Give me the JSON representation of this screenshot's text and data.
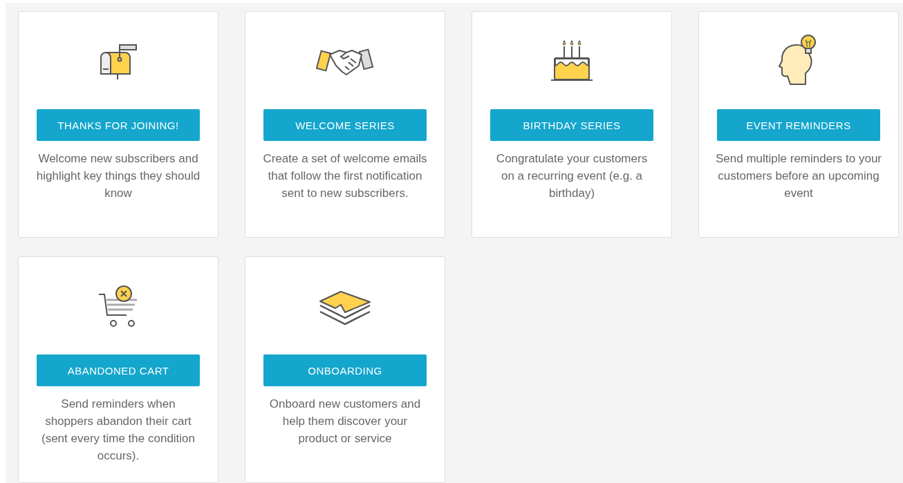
{
  "templates": [
    {
      "button": "THANKS FOR JOINING!",
      "description": "Welcome new subscribers and highlight key things they should know"
    },
    {
      "button": "WELCOME SERIES",
      "description": "Create a set of welcome emails that follow the first notification sent to new subscribers."
    },
    {
      "button": "BIRTHDAY SERIES",
      "description": "Congratulate your customers on a recurring event (e.g. a birthday)"
    },
    {
      "button": "EVENT REMINDERS",
      "description": "Send multiple reminders to your customers before an upcoming event"
    },
    {
      "button": "ABANDONED CART",
      "description": "Send reminders when shoppers abandon their cart (sent every time the condition occurs)."
    },
    {
      "button": "ONBOARDING",
      "description": "Onboard new customers and help them discover your product or service"
    }
  ]
}
